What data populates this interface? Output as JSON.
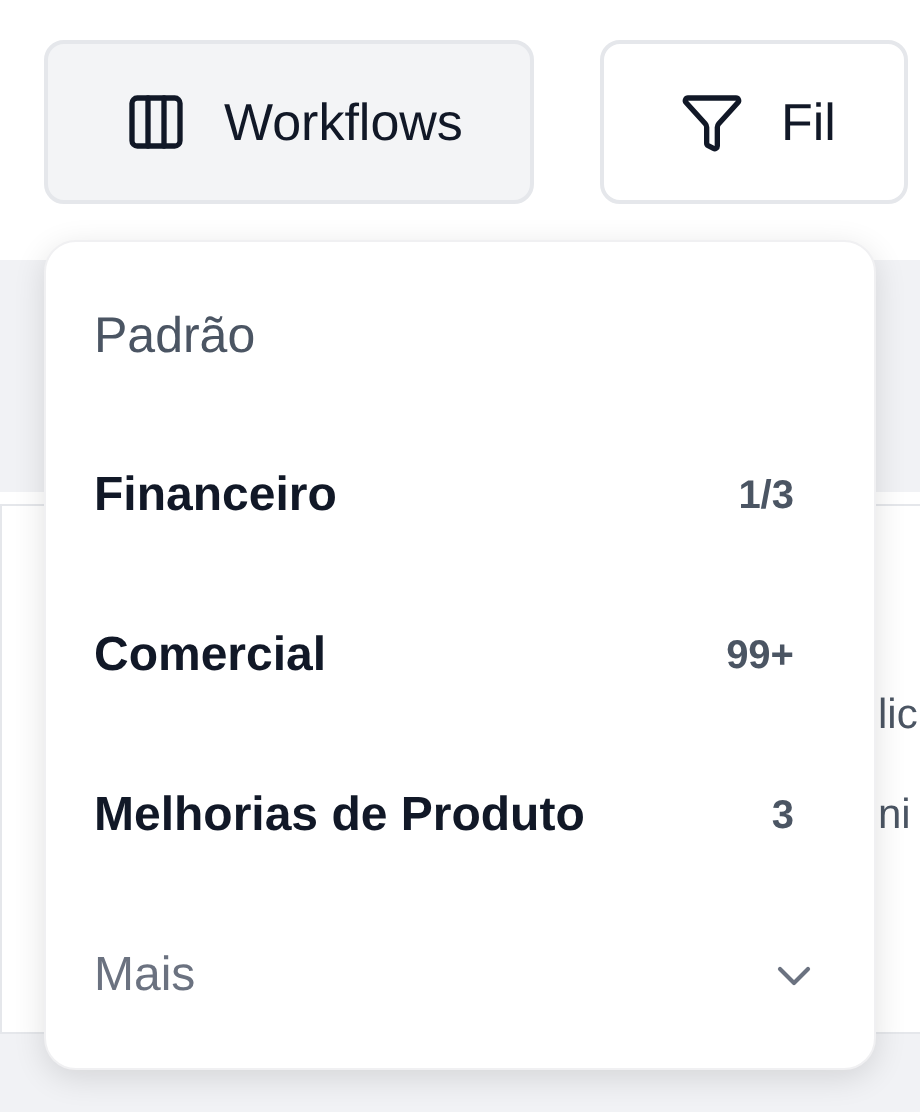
{
  "toolbar": {
    "buttons": [
      {
        "label": "Workflows",
        "kind": "columns",
        "selected": true
      },
      {
        "label": "Fil",
        "kind": "filter",
        "selected": false
      }
    ]
  },
  "menu": {
    "header": "Padrão",
    "items": [
      {
        "label": "Financeiro",
        "count": "1/3"
      },
      {
        "label": "Comercial",
        "count": "99+"
      },
      {
        "label": "Melhorias de Produto",
        "count": "3"
      }
    ],
    "more": {
      "label": "Mais",
      "expanded": false
    }
  },
  "background_lines": [
    "lic",
    "ni"
  ]
}
